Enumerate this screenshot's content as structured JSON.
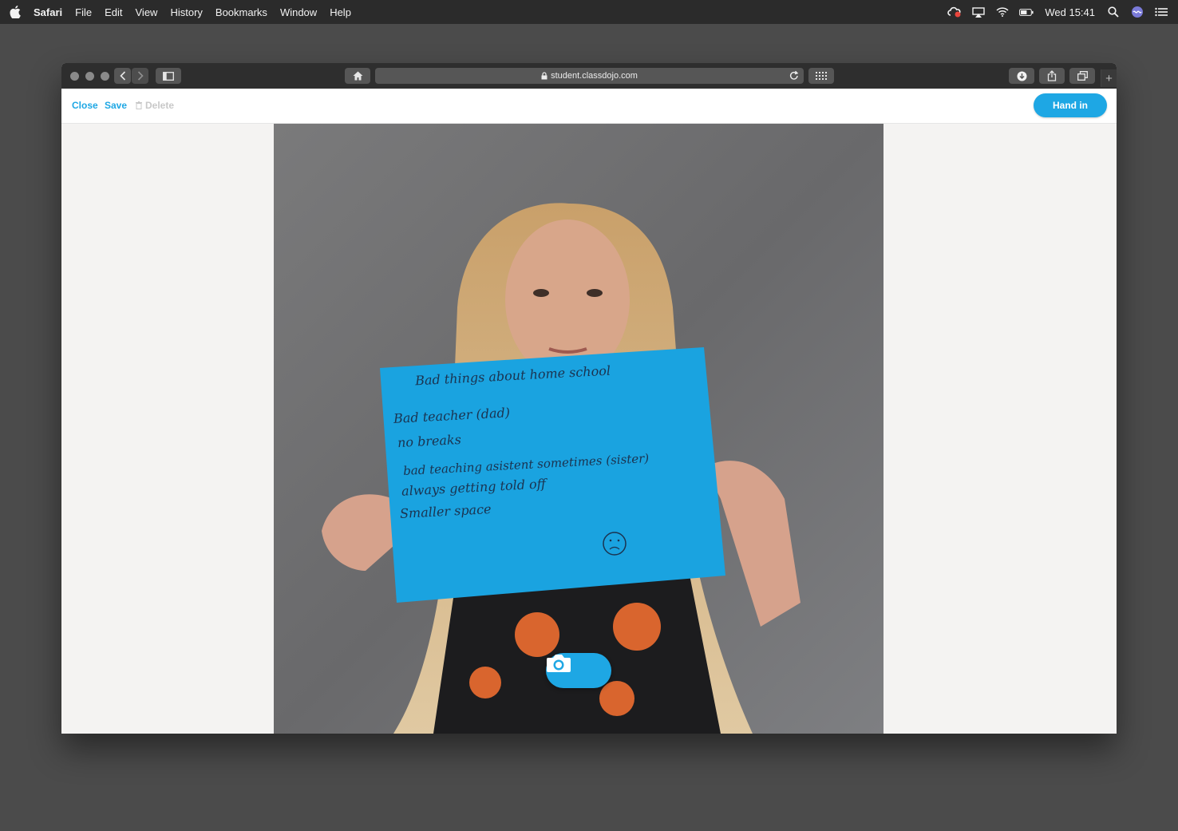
{
  "menubar": {
    "app_name": "Safari",
    "items": [
      "File",
      "Edit",
      "View",
      "History",
      "Bookmarks",
      "Window",
      "Help"
    ],
    "clock": "Wed 15:41"
  },
  "browser": {
    "url": "student.classdojo.com"
  },
  "toolbar": {
    "close_label": "Close",
    "save_label": "Save",
    "delete_label": "Delete",
    "hand_in_label": "Hand in"
  },
  "photo": {
    "sign_lines": [
      "Bad things about home school",
      "Bad teacher (dad)",
      "no breaks",
      "bad teaching asistent sometimes (sister)",
      "always getting told off",
      "Smaller space"
    ]
  },
  "colors": {
    "accent": "#1ea7e4",
    "sign": "#1aa3e0",
    "wall": "#6e6e70"
  }
}
